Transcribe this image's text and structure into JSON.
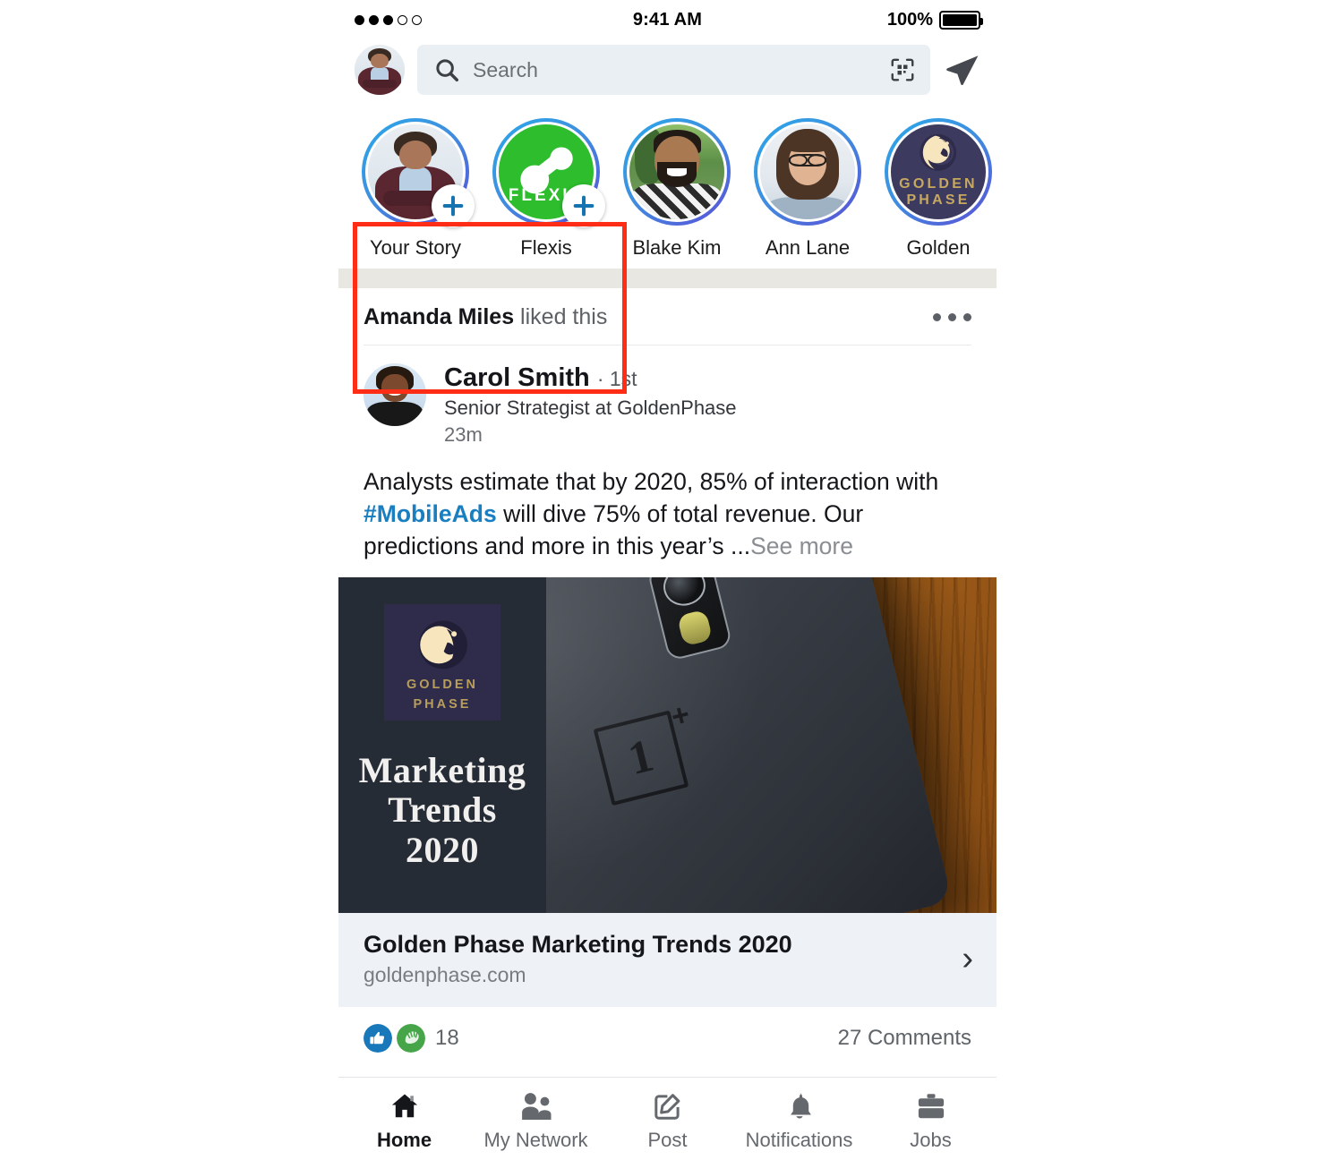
{
  "status_bar": {
    "signal_dots_filled": 3,
    "signal_dots_total": 5,
    "time": "9:41 AM",
    "battery_label": "100%"
  },
  "top_bar": {
    "avatar_name": "me-avatar",
    "search_placeholder": "Search",
    "search_value": "",
    "qr_icon": "qr-scan-icon",
    "send_icon": "send-message-icon"
  },
  "stories": {
    "highlight_label": "highlighted-region",
    "items": [
      {
        "label": "Your Story",
        "has_add_badge": true,
        "kind": "photo-man1"
      },
      {
        "label": "Flexis",
        "has_add_badge": true,
        "kind": "brand-flexis",
        "brand_text": "FLEXIS"
      },
      {
        "label": "Blake Kim",
        "has_add_badge": false,
        "kind": "photo-man2"
      },
      {
        "label": "Ann Lane",
        "has_add_badge": false,
        "kind": "photo-woman1"
      },
      {
        "label": "Golden",
        "has_add_badge": false,
        "kind": "brand-golden",
        "brand_line1": "GOLDEN",
        "brand_line2": "PHASE"
      }
    ]
  },
  "post": {
    "social_proof_actor": "Amanda Miles",
    "social_proof_action": " liked this",
    "menu_icon": "more-options-icon",
    "author": {
      "name": "Carol Smith",
      "degree": "· 1st",
      "headline": "Senior Strategist at GoldenPhase",
      "time": "23m"
    },
    "body": {
      "part1": "Analysts estimate that by 2020, 85% of interaction with ",
      "hashtag": "#MobileAds",
      "part2": " will dive 75% of total revenue. Our predictions and more in this year’s ...",
      "see_more": "See more"
    },
    "media": {
      "brand_line1": "GOLDEN",
      "brand_line2": "PHASE",
      "headline_line1": "Marketing",
      "headline_line2": "Trends",
      "headline_line3": "2020",
      "photo_alt": "oneplus-phone-on-wood-desk",
      "phone_brand_mark": "1"
    },
    "link": {
      "title": "Golden Phase Marketing Trends 2020",
      "url": "goldenphase.com",
      "chevron": "›"
    },
    "reactions": {
      "like_icon": "thumbs-up-reaction-icon",
      "celebrate_icon": "clap-reaction-icon",
      "count": "18",
      "comments": "27 Comments"
    }
  },
  "bottom_nav": {
    "items": [
      {
        "label": "Home",
        "icon": "home-icon",
        "active": true
      },
      {
        "label": "My Network",
        "icon": "people-icon",
        "active": false
      },
      {
        "label": "Post",
        "icon": "compose-icon",
        "active": false
      },
      {
        "label": "Notifications",
        "icon": "bell-icon",
        "active": false
      },
      {
        "label": "Jobs",
        "icon": "briefcase-icon",
        "active": false
      }
    ]
  },
  "colors": {
    "accent_blue": "#1a7fc1",
    "highlight_red": "#ff2d16",
    "story_ring_start": "#2aa8e8",
    "story_ring_end": "#5b4fd6",
    "brand_green": "#2dbd2d",
    "golden_navy": "#2f2c4b",
    "golden_gold": "#b99d5b"
  }
}
